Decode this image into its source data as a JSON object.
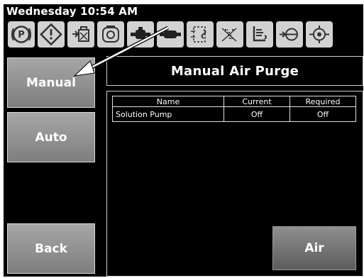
{
  "status_bar": {
    "clock": "Wednesday 10:54 AM"
  },
  "toolbar": {
    "icons": [
      {
        "name": "parking-icon",
        "state": "normal"
      },
      {
        "name": "warning-diamond-icon",
        "state": "normal"
      },
      {
        "name": "solution-pump-icon",
        "state": "normal"
      },
      {
        "name": "engine-icon",
        "state": "normal"
      },
      {
        "name": "pump-icon",
        "state": "normal"
      },
      {
        "name": "motor-icon",
        "state": "normal"
      },
      {
        "name": "heater-icon",
        "state": "normal"
      },
      {
        "name": "heat-exchanger-icon",
        "state": "normal"
      },
      {
        "name": "tank-level-icon",
        "state": "normal"
      },
      {
        "name": "valve-icon",
        "state": "normal"
      },
      {
        "name": "blower-icon",
        "state": "normal"
      }
    ]
  },
  "sidebar": {
    "manual_label": "Manual",
    "auto_label": "Auto",
    "back_label": "Back"
  },
  "main": {
    "title": "Manual Air Purge",
    "table": {
      "headers": [
        "Name",
        "Current",
        "Required"
      ],
      "rows": [
        {
          "name": "Solution Pump",
          "current": "Off",
          "required": "Off"
        }
      ]
    },
    "air_label": "Air"
  },
  "colors": {
    "screen_bg": "#000000",
    "button_gray": "#8c8c8c",
    "icon_bg": "#d2d2d2",
    "text": "#ffffff"
  }
}
